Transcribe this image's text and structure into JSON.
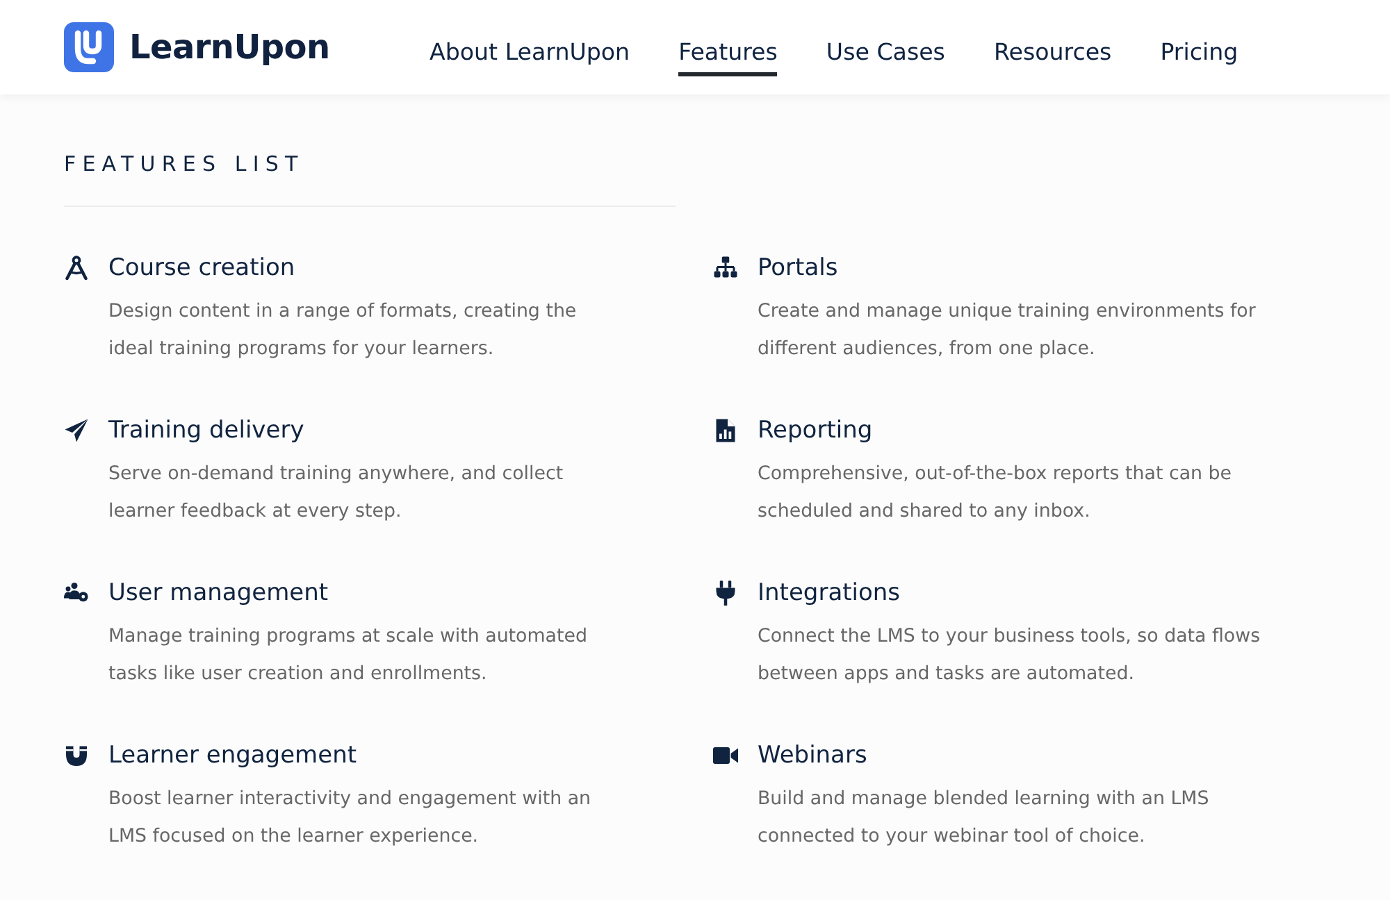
{
  "header": {
    "brand": "LearnUpon",
    "nav": [
      {
        "label": "About LearnUpon",
        "selected": false
      },
      {
        "label": "Features",
        "selected": true
      },
      {
        "label": "Use Cases",
        "selected": false
      },
      {
        "label": "Resources",
        "selected": false
      },
      {
        "label": "Pricing",
        "selected": false
      }
    ]
  },
  "features_panel": {
    "heading": "FEATURES LIST",
    "features": [
      {
        "title": "Course creation",
        "description_lines": [
          "Design content in a range of formats, creating the",
          "ideal training programs for your learners."
        ]
      },
      {
        "title": "Portals",
        "description_lines": [
          "Create and manage unique training environments for",
          "different audiences, from one place."
        ]
      },
      {
        "title": "Training delivery",
        "description_lines": [
          "Serve on-demand training anywhere, and collect",
          "learner feedback at every step."
        ]
      },
      {
        "title": "Reporting",
        "description_lines": [
          "Comprehensive, out-of-the-box reports that can be",
          "scheduled and shared to any inbox."
        ]
      },
      {
        "title": "User management",
        "description_lines": [
          "Manage training programs at scale with automated",
          "tasks like user creation and enrollments."
        ]
      },
      {
        "title": "Integrations",
        "description_lines": [
          "Connect the LMS to your business tools, so data flows",
          "between apps and tasks are automated."
        ]
      },
      {
        "title": "Learner engagement",
        "description_lines": [
          "Boost learner interactivity and engagement with an",
          "LMS focused on the learner experience."
        ]
      },
      {
        "title": "Webinars",
        "description_lines": [
          "Build and manage blended learning with an LMS",
          "connected to your webinar tool of choice."
        ]
      }
    ]
  }
}
